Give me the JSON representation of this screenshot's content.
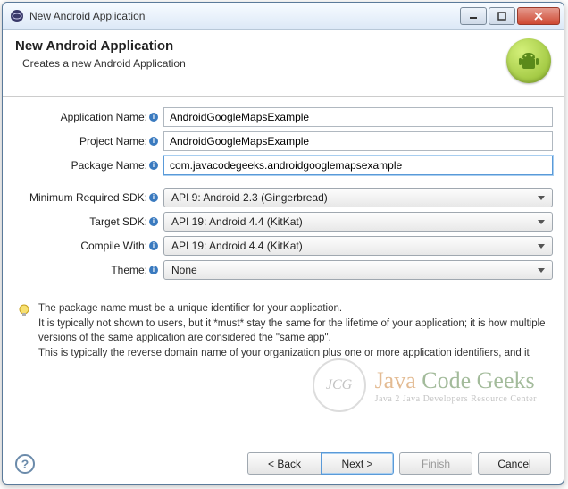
{
  "titlebar": {
    "title": "New Android Application"
  },
  "header": {
    "title": "New Android Application",
    "subtitle": "Creates a new Android Application"
  },
  "fields": {
    "app_name": {
      "label": "Application Name:",
      "value": "AndroidGoogleMapsExample"
    },
    "project_name": {
      "label": "Project Name:",
      "value": "AndroidGoogleMapsExample"
    },
    "package_name": {
      "label": "Package Name:",
      "value": "com.javacodegeeks.androidgooglemapsexample"
    },
    "min_sdk": {
      "label": "Minimum Required SDK:",
      "value": "API 9: Android 2.3 (Gingerbread)"
    },
    "target_sdk": {
      "label": "Target SDK:",
      "value": "API 19: Android 4.4 (KitKat)"
    },
    "compile_with": {
      "label": "Compile With:",
      "value": "API 19: Android 4.4 (KitKat)"
    },
    "theme": {
      "label": "Theme:",
      "value": "None"
    }
  },
  "hint": {
    "line1": "The package name must be a unique identifier for your application.",
    "line2": "It is typically not shown to users, but it *must* stay the same for the lifetime of your application; it is how multiple versions of the same application are considered the \"same app\".",
    "line3": "This is typically the reverse domain name of your organization plus one or more application identifiers, and it"
  },
  "watermark": {
    "circle": "JCG",
    "main_java": "Java",
    "main_code": "Code",
    "main_geeks": "Geeks",
    "sub": "Java 2 Java Developers Resource Center"
  },
  "buttons": {
    "back": "< Back",
    "next": "Next >",
    "finish": "Finish",
    "cancel": "Cancel"
  }
}
